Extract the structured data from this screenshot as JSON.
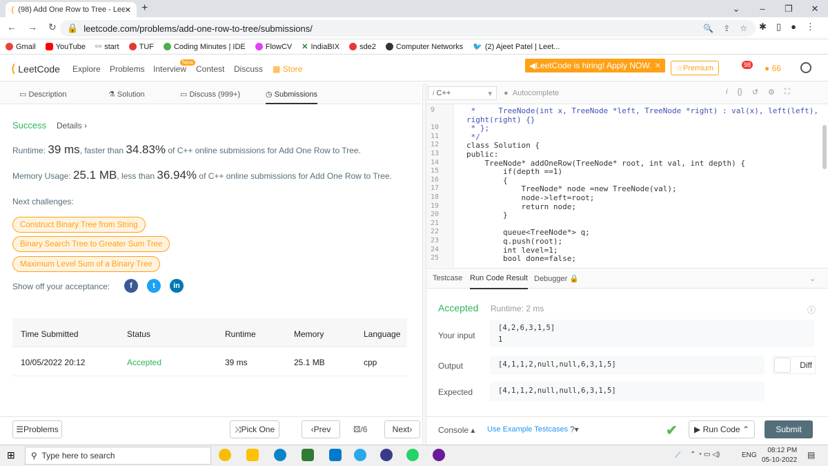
{
  "browser": {
    "tab_title": "(98) Add One Row to Tree - LeetC",
    "url": "leetcode.com/problems/add-one-row-to-tree/submissions/",
    "bookmarks": [
      "Gmail",
      "YouTube",
      "start",
      "TUF",
      "Coding Minutes | IDE",
      "FlowCV",
      "IndiaBIX",
      "sde2",
      "Computer Networks",
      "(2) Ajeet Patel | Leet..."
    ]
  },
  "nav": {
    "logo": "LeetCode",
    "links": [
      "Explore",
      "Problems",
      "Interview",
      "Contest",
      "Discuss",
      "Store"
    ],
    "new_badge": "New",
    "hiring": "LeetCode is hiring! Apply NOW.",
    "premium": "Premium",
    "notif_count": "98",
    "streak": "66"
  },
  "left_tabs": [
    "Description",
    "Solution",
    "Discuss (999+)",
    "Submissions"
  ],
  "result": {
    "status": "Success",
    "details": "Details",
    "runtime_label": "Runtime:",
    "runtime_value": "39 ms",
    "runtime_mid": ", faster than ",
    "runtime_pct": "34.83%",
    "runtime_tail": " of C++ online submissions for Add One Row to Tree.",
    "memory_label": "Memory Usage:",
    "memory_value": "25.1 MB",
    "memory_mid": ", less than ",
    "memory_pct": "36.94%",
    "memory_tail": " of C++ online submissions for Add One Row to Tree."
  },
  "challenges": {
    "title": "Next challenges:",
    "items": [
      "Construct Binary Tree from String",
      "Binary Search Tree to Greater Sum Tree",
      "Maximum Level Sum of a Binary Tree"
    ]
  },
  "show_off": "Show off your acceptance:",
  "table": {
    "headers": [
      "Time Submitted",
      "Status",
      "Runtime",
      "Memory",
      "Language"
    ],
    "row": [
      "10/05/2022 20:12",
      "Accepted",
      "39 ms",
      "25.1 MB",
      "cpp"
    ]
  },
  "left_bottom": {
    "problems": "Problems",
    "pick_one": "Pick One",
    "prev": "Prev",
    "page": "/6",
    "next": "Next"
  },
  "editor": {
    "language": "C++",
    "autocomplete": "Autocomplete",
    "lines": [
      {
        "n": "9",
        "t": " *     TreeNode(int x, TreeNode *left, TreeNode *right) : val(x), left(left),"
      },
      {
        "n": "",
        "t": "right(right) {}"
      },
      {
        "n": "10",
        "t": " * };"
      },
      {
        "n": "11",
        "t": " */"
      },
      {
        "n": "12",
        "t": "class Solution {"
      },
      {
        "n": "13",
        "t": "public:"
      },
      {
        "n": "14",
        "t": "    TreeNode* addOneRow(TreeNode* root, int val, int depth) {"
      },
      {
        "n": "15",
        "t": "        if(depth ==1)"
      },
      {
        "n": "16",
        "t": "        {"
      },
      {
        "n": "17",
        "t": "            TreeNode* node =new TreeNode(val);"
      },
      {
        "n": "18",
        "t": "            node->left=root;"
      },
      {
        "n": "19",
        "t": "            return node;"
      },
      {
        "n": "20",
        "t": "        }"
      },
      {
        "n": "21",
        "t": ""
      },
      {
        "n": "22",
        "t": "        queue<TreeNode*> q;"
      },
      {
        "n": "23",
        "t": "        q.push(root);"
      },
      {
        "n": "24",
        "t": "        int level=1;"
      },
      {
        "n": "25",
        "t": "        bool done=false;"
      }
    ]
  },
  "run_tabs": [
    "Testcase",
    "Run Code Result",
    "Debugger"
  ],
  "run_result": {
    "status": "Accepted",
    "runtime": "Runtime: 2 ms",
    "your_input_label": "Your input",
    "your_input": "[4,2,6,3,1,5]",
    "your_input2": "1",
    "output_label": "Output",
    "output": "[4,1,1,2,null,null,6,3,1,5]",
    "expected_label": "Expected",
    "expected": "[4,1,1,2,null,null,6,3,1,5]",
    "diff": "Diff"
  },
  "right_bottom": {
    "console": "Console",
    "use_example": "Use Example Testcases",
    "run_code": "Run Code",
    "submit": "Submit"
  },
  "taskbar": {
    "search": "Type here to search",
    "lang": "ENG",
    "time": "08:12 PM",
    "date": "05-10-2022"
  }
}
